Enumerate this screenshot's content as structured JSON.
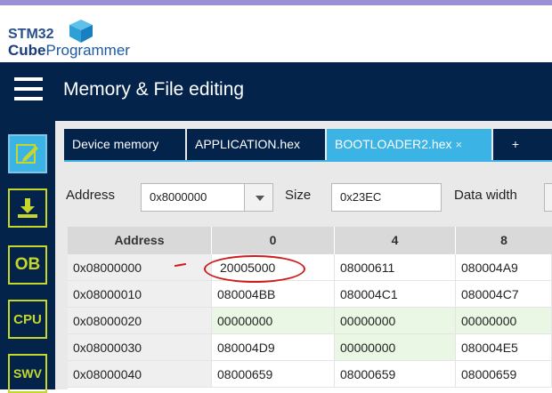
{
  "app": {
    "logo_top": "STM32",
    "logo_bottom_bold": "Cube",
    "logo_bottom_rest": "Programmer"
  },
  "header": {
    "title": "Memory & File editing"
  },
  "sidebar": {
    "items": [
      {
        "label": "",
        "icon": "pencil-icon"
      },
      {
        "label": "",
        "icon": "download-icon"
      },
      {
        "label": "OB"
      },
      {
        "label": "CPU"
      },
      {
        "label": "SWV"
      }
    ]
  },
  "tabs": [
    {
      "label": "Device memory",
      "active": false
    },
    {
      "label": "APPLICATION.hex",
      "active": false
    },
    {
      "label": "BOOTLOADER2.hex",
      "active": true,
      "close": "×"
    },
    {
      "label": "+",
      "active": false
    }
  ],
  "toolbar": {
    "address_label": "Address",
    "address_value": "0x8000000",
    "size_label": "Size",
    "size_value": "0x23EC",
    "width_label": "Data width"
  },
  "table": {
    "headers": [
      "Address",
      "0",
      "4",
      "8"
    ],
    "rows": [
      [
        "0x08000000",
        "20005000",
        "08000611",
        "080004A9"
      ],
      [
        "0x08000010",
        "080004BB",
        "080004C1",
        "080004C7"
      ],
      [
        "0x08000020",
        "00000000",
        "00000000",
        "00000000"
      ],
      [
        "0x08000030",
        "080004D9",
        "00000000",
        "080004E5"
      ],
      [
        "0x08000040",
        "08000659",
        "08000659",
        "08000659"
      ]
    ]
  },
  "colors": {
    "navy": "#03234b",
    "accent": "#3bb3e5",
    "lime": "#c5d82a",
    "zero_row": "#eaf7e4",
    "annotation": "#d11b1b"
  }
}
